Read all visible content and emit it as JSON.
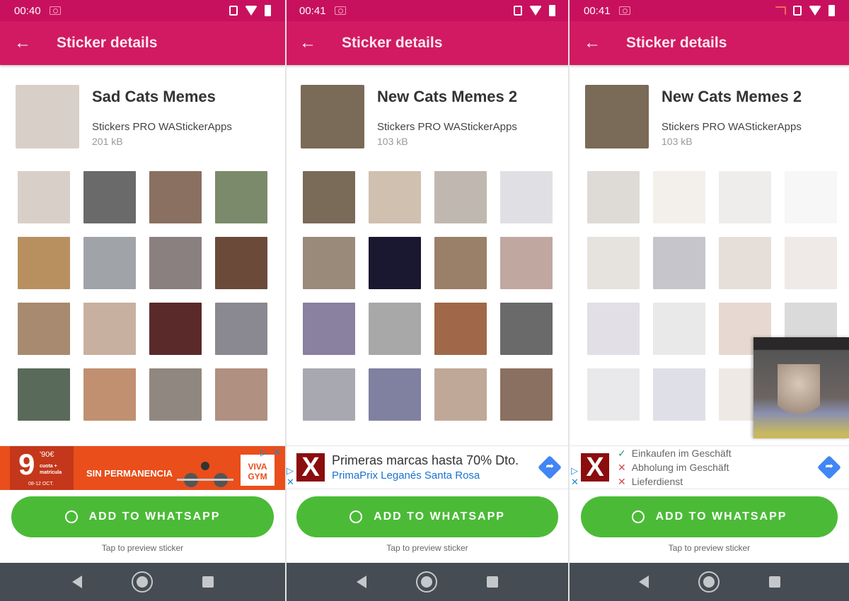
{
  "panels": [
    {
      "time": "00:40",
      "cast": false,
      "title": "Sticker details",
      "pack_name": "Sad Cats Memes",
      "publisher": "Stickers PRO WAStickerApps",
      "size": "201 kB",
      "sticker_colors": [
        "#d8d0c8",
        "#6a6a6a",
        "#8a7060",
        "#7a8a6a",
        "#b89060",
        "#a0a4a8",
        "#8a8080",
        "#6b4a3a",
        "#a88a70",
        "#c8b0a0",
        "#5a2a2a",
        "#8a8890",
        "#5a6a5a",
        "#c09070",
        "#908880",
        "#b09080"
      ],
      "ad": {
        "type": "gym",
        "price": "9",
        "cents": "'90€",
        "sub": "cuota + matrícula",
        "date": "08-12 OCT.",
        "text": "SIN PERMANENCIA",
        "brand": "VIVA GYM"
      }
    },
    {
      "time": "00:41",
      "cast": false,
      "title": "Sticker details",
      "pack_name": "New Cats Memes 2",
      "publisher": "Stickers PRO WAStickerApps",
      "size": "103 kB",
      "sticker_colors": [
        "#7a6a58",
        "#d0c0b0",
        "#c0b8b0",
        "#e0e0e4",
        "#9a8a7a",
        "#1a1830",
        "#9a8068",
        "#c0a8a0",
        "#8a80a0",
        "#a8a8a8",
        "#a06848",
        "#6a6a6a",
        "#a8a8b0",
        "#8080a0",
        "#c0a898",
        "#8a7060"
      ],
      "ad": {
        "type": "text",
        "headline": "Primeras marcas hasta 70% Dto.",
        "subline": "PrimaPrix Leganés Santa Rosa"
      }
    },
    {
      "time": "00:41",
      "cast": true,
      "title": "Sticker details",
      "pack_name": "New Cats Memes 2",
      "publisher": "Stickers PRO WAStickerApps",
      "size": "103 kB",
      "sticker_colors": [
        "#7a6a58",
        "#d0c0b0",
        "#c0b8b0",
        "#e0e0e4",
        "#9a8a7a",
        "#1a1830",
        "#9a8068",
        "#c0a8a0",
        "#8a80a0",
        "#a8a8a8",
        "#a06848",
        "#6a6a6a",
        "#a8a8b0",
        "#8080a0",
        "#c0a898",
        "#8a7060"
      ],
      "ad": {
        "type": "features",
        "features": [
          {
            "ok": true,
            "label": "Einkaufen im Geschäft"
          },
          {
            "ok": false,
            "label": "Abholung im Geschäft"
          },
          {
            "ok": false,
            "label": "Lieferdienst"
          }
        ]
      }
    }
  ],
  "button_label": "ADD TO WHATSAPP",
  "hint": "Tap to preview sticker",
  "icons": {
    "back": "←",
    "check": "✓",
    "cross": "✕",
    "adchoice_play": "▷",
    "adchoice_close": "✕",
    "direction": "➦",
    "logo_x": "X"
  },
  "colors": {
    "status": "#c8115e",
    "appbar": "#d11a62",
    "button": "#4bbb37",
    "navbar": "#454c53"
  }
}
